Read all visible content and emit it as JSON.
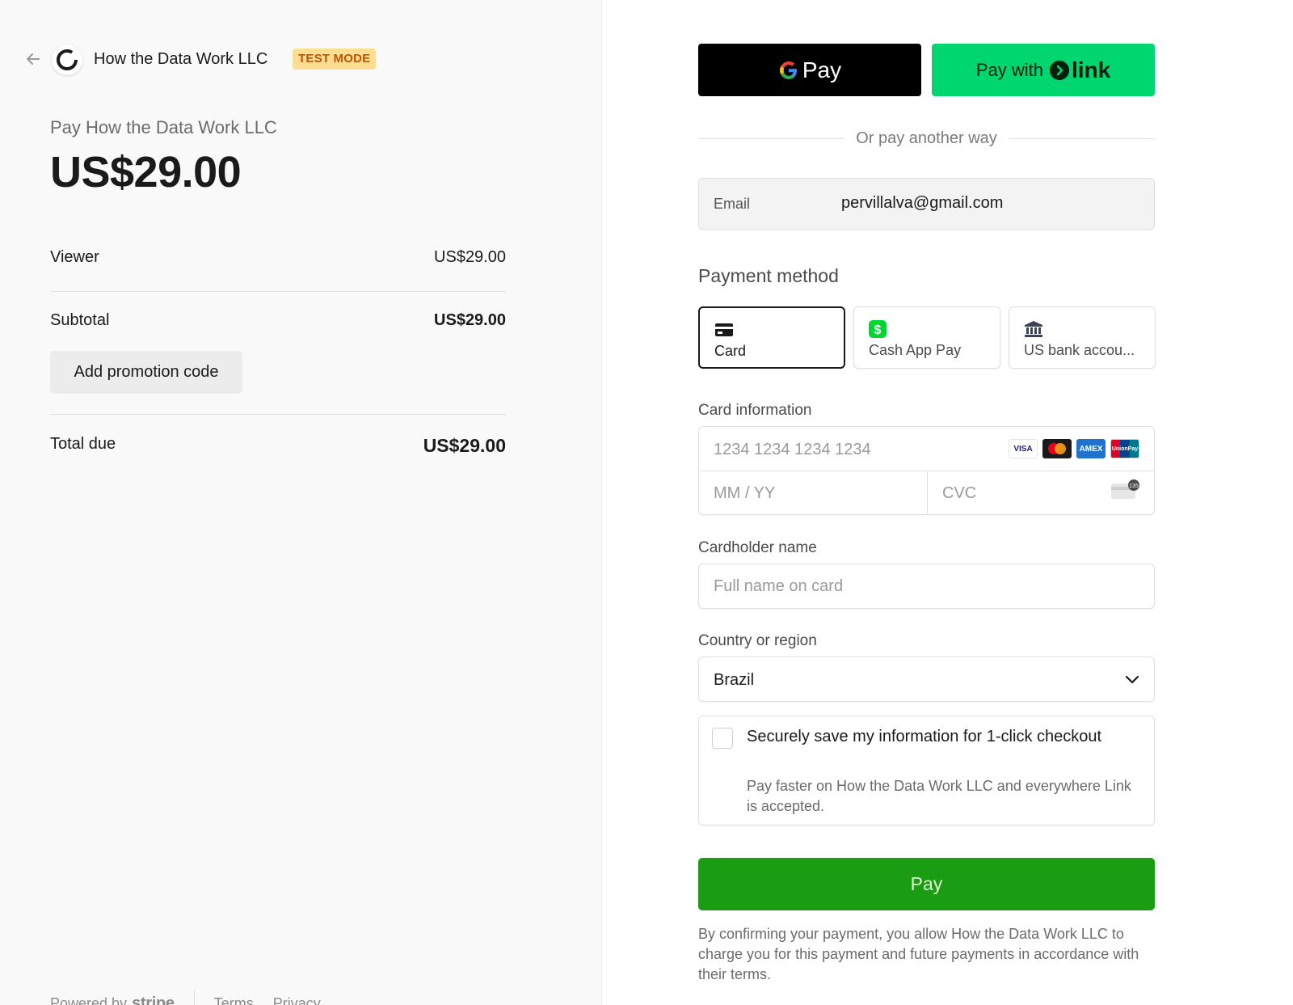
{
  "header": {
    "merchant_name": "How the Data Work LLC",
    "test_badge": "TEST MODE"
  },
  "summary": {
    "pay_to": "Pay How the Data Work LLC",
    "amount": "US$29.00",
    "items": [
      {
        "label": "Viewer",
        "value": "US$29.00"
      }
    ],
    "subtotal_label": "Subtotal",
    "subtotal_value": "US$29.00",
    "promo_label": "Add promotion code",
    "total_label": "Total due",
    "total_value": "US$29.00"
  },
  "footer": {
    "powered_by": "Powered by",
    "brand": "stripe",
    "terms": "Terms",
    "privacy": "Privacy"
  },
  "express": {
    "gpay_label": "Pay",
    "link_prefix": "Pay with",
    "link_word": "link",
    "separator": "Or pay another way"
  },
  "email": {
    "label": "Email",
    "value": "pervillalva@gmail.com"
  },
  "payment_method": {
    "title": "Payment method",
    "tabs": [
      {
        "label": "Card",
        "icon": "card-icon"
      },
      {
        "label": "Cash App Pay",
        "icon": "cash-app-icon"
      },
      {
        "label": "US bank accou...",
        "icon": "bank-icon"
      }
    ]
  },
  "card": {
    "label": "Card information",
    "number_placeholder": "1234 1234 1234 1234",
    "expiry_placeholder": "MM / YY",
    "cvc_placeholder": "CVC",
    "brands": [
      "VISA",
      "mastercard",
      "AMEX",
      "UnionPay"
    ],
    "cvc_icon_text": "135"
  },
  "cardholder": {
    "label": "Cardholder name",
    "placeholder": "Full name on card"
  },
  "country": {
    "label": "Country or region",
    "value": "Brazil"
  },
  "save": {
    "title": "Securely save my information for 1-click checkout",
    "description": "Pay faster on How the Data Work LLC and everywhere Link is accepted."
  },
  "pay_button": "Pay",
  "legal": "By confirming your payment, you allow How the Data Work LLC to charge you for this payment and future payments in accordance with their terms.",
  "colors": {
    "pay_green": "#1a9d12",
    "link_green": "#00d66f",
    "test_badge_bg": "#ffde92",
    "test_badge_text": "#bb5504"
  }
}
